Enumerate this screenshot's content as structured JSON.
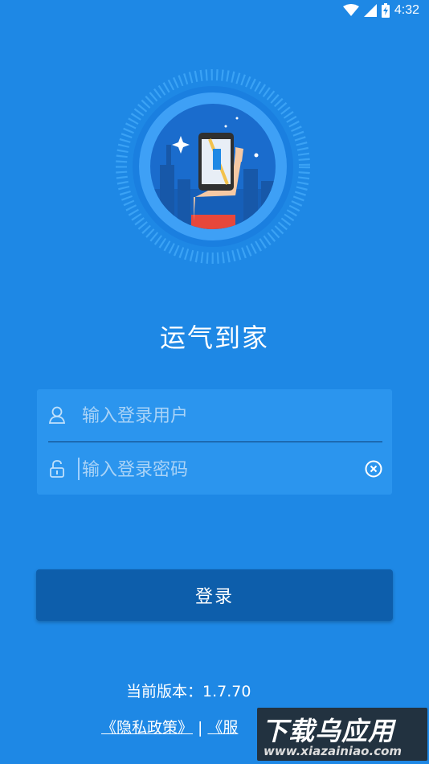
{
  "status_bar": {
    "time": "4:32",
    "icons": [
      "wifi-icon",
      "cellular-signal-icon",
      "battery-charging-icon"
    ]
  },
  "app": {
    "title": "运气到家",
    "logo_icon": "phone-in-hand-map-icon"
  },
  "login": {
    "username_placeholder": "输入登录用户",
    "password_placeholder": "输入登录密码",
    "username_icon": "user-icon",
    "password_icon": "lock-icon",
    "clear_icon": "clear-circle-icon",
    "button_label": "登录"
  },
  "footer": {
    "version_text": "当前版本：1.7.70",
    "privacy_link": "《隐私政策》",
    "separator": "|",
    "service_link": "《服"
  },
  "watermark": {
    "title": "下载乌应用",
    "url": "www.xiazainiao.com"
  },
  "colors": {
    "background": "#1e88e5",
    "card": "#2b95ee",
    "button": "#0d5eab",
    "placeholder": "#a9d3f7"
  }
}
